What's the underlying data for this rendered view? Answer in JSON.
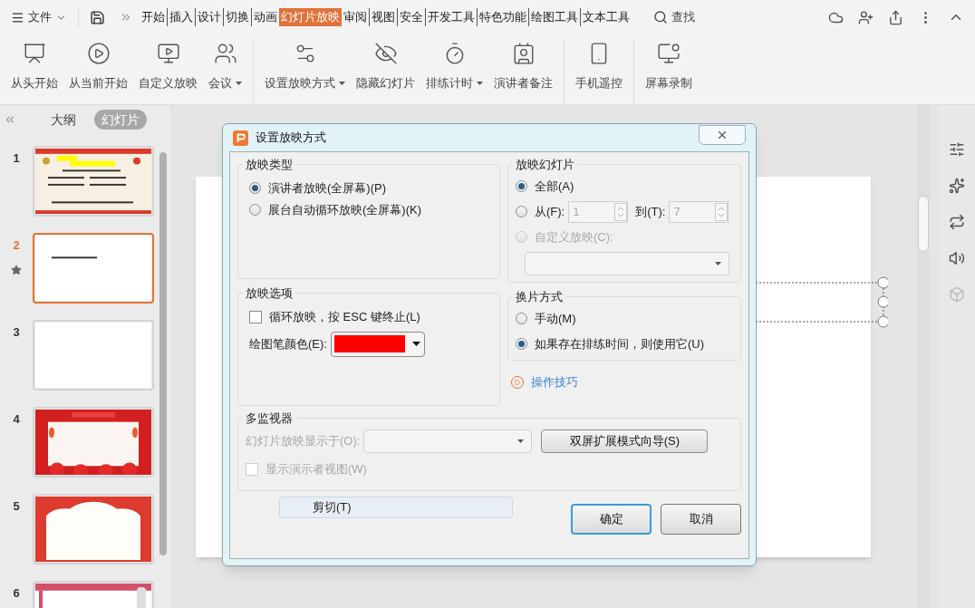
{
  "menu": {
    "file": "文件",
    "tabs": [
      {
        "label": "开始",
        "selected": false
      },
      {
        "label": "插入",
        "selected": false
      },
      {
        "label": "设计",
        "selected": false
      },
      {
        "label": "切换",
        "selected": false
      },
      {
        "label": "动画",
        "selected": false
      },
      {
        "label": "幻灯片放映",
        "selected": true
      },
      {
        "label": "审阅",
        "selected": false
      },
      {
        "label": "视图",
        "selected": false
      },
      {
        "label": "安全",
        "selected": false
      },
      {
        "label": "开发工具",
        "selected": false
      },
      {
        "label": "特色功能",
        "selected": false
      },
      {
        "label": "绘图工具",
        "selected": false
      },
      {
        "label": "文本工具",
        "selected": false
      }
    ],
    "search": "查找"
  },
  "ribbon": {
    "groups": [
      [
        {
          "label": "从头开始",
          "dropdown": false
        },
        {
          "label": "从当前开始",
          "dropdown": false
        },
        {
          "label": "自定义放映",
          "dropdown": false
        },
        {
          "label": "会议",
          "dropdown": true
        }
      ],
      [
        {
          "label": "设置放映方式",
          "dropdown": true
        },
        {
          "label": "隐藏幻灯片",
          "dropdown": false
        },
        {
          "label": "排练计时",
          "dropdown": true
        },
        {
          "label": "演讲者备注",
          "dropdown": false
        }
      ],
      [
        {
          "label": "手机遥控",
          "dropdown": false
        }
      ],
      [
        {
          "label": "屏幕录制",
          "dropdown": false
        }
      ]
    ]
  },
  "slide_panel": {
    "tabs": [
      {
        "label": "大纲",
        "selected": false
      },
      {
        "label": "幻灯片",
        "selected": true
      }
    ],
    "slides": [
      {
        "number": "1",
        "kind": "certificate",
        "selected": false,
        "starred": false
      },
      {
        "number": "2",
        "kind": "text",
        "selected": true,
        "starred": true
      },
      {
        "number": "3",
        "kind": "blank",
        "selected": false,
        "starred": false
      },
      {
        "number": "4",
        "kind": "stage",
        "selected": false,
        "starred": false
      },
      {
        "number": "5",
        "kind": "arch",
        "selected": false,
        "starred": false
      },
      {
        "number": "6",
        "kind": "scroll",
        "selected": false,
        "starred": false
      }
    ]
  },
  "dialog": {
    "title": "设置放映方式",
    "show_type": {
      "title": "放映类型",
      "options": [
        {
          "label": "演讲者放映(全屏幕)(P)",
          "selected": true
        },
        {
          "label": "展台自动循环放映(全屏幕)(K)",
          "selected": false
        }
      ]
    },
    "show_slides": {
      "title": "放映幻灯片",
      "all": {
        "label": "全部(A)",
        "selected": true
      },
      "range": {
        "label": "从(F):",
        "selected": false,
        "from": "1",
        "to_label": "到(T):",
        "to": "7"
      },
      "custom": {
        "label": "自定义放映(C):",
        "selected": false,
        "disabled": true
      }
    },
    "options": {
      "title": "放映选项",
      "loop": {
        "label": "循环放映，按 ESC 键终止(L)",
        "checked": false
      },
      "pen_label": "绘图笔颜色(E):",
      "color": "#ff0000"
    },
    "advance": {
      "title": "换片方式",
      "options": [
        {
          "label": "手动(M)",
          "selected": false
        },
        {
          "label": "如果存在排练时间，则使用它(U)",
          "selected": true
        }
      ]
    },
    "tips_link": "操作技巧",
    "monitors": {
      "title": "多监视器",
      "display_label": "幻灯片放映显示于(O):",
      "disabled": true,
      "wizard_button": "双屏扩展模式向导(S)",
      "presenter_view": {
        "label": "显示演示者视图(W)",
        "checked": false
      }
    },
    "menu_item": "剪切(T)",
    "buttons": [
      {
        "label": "确定",
        "default": true
      },
      {
        "label": "取消",
        "default": false
      }
    ]
  }
}
